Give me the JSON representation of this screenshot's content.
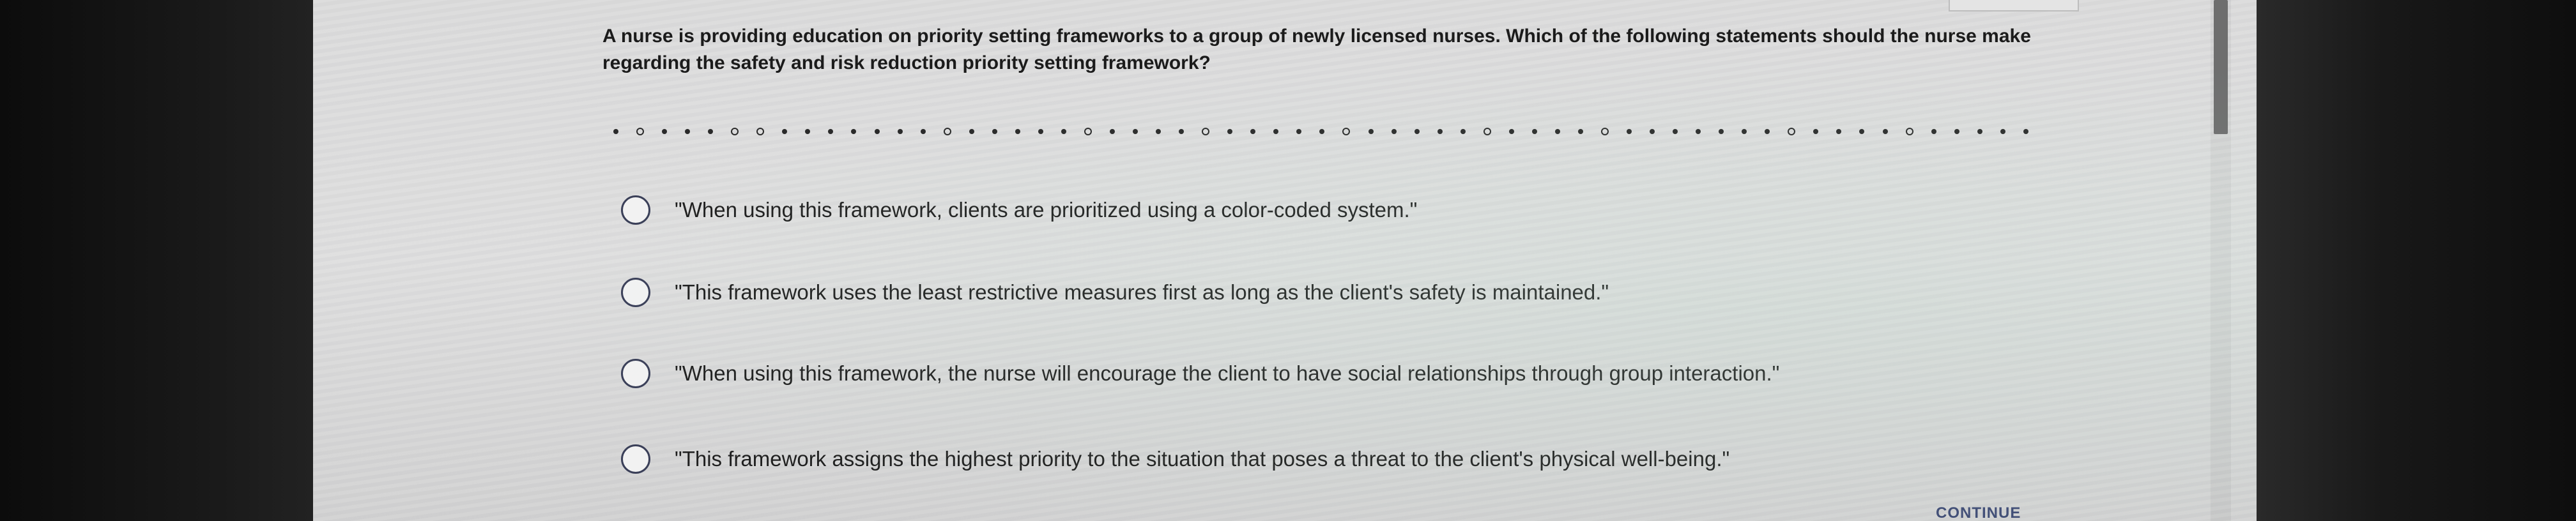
{
  "question": {
    "text": "A nurse is providing education on priority setting frameworks to a group of newly licensed nurses. Which of the following statements should the nurse make regarding the safety and risk reduction priority setting framework?"
  },
  "options": [
    {
      "label": "\"When using this framework, clients are prioritized using a color-coded system.\""
    },
    {
      "label": "\"This framework uses the least restrictive measures first as long as the client's safety is maintained.\""
    },
    {
      "label": "\"When using this framework, the nurse will encourage the client to have social relationships through group interaction.\""
    },
    {
      "label": "\"This framework assigns the highest priority to the situation that poses a threat to the client's physical well-being.\""
    }
  ],
  "actions": {
    "continue_label": "CONTINUE"
  },
  "colors": {
    "radio_border": "#3a3f58",
    "continue_text": "#3e4a74"
  }
}
